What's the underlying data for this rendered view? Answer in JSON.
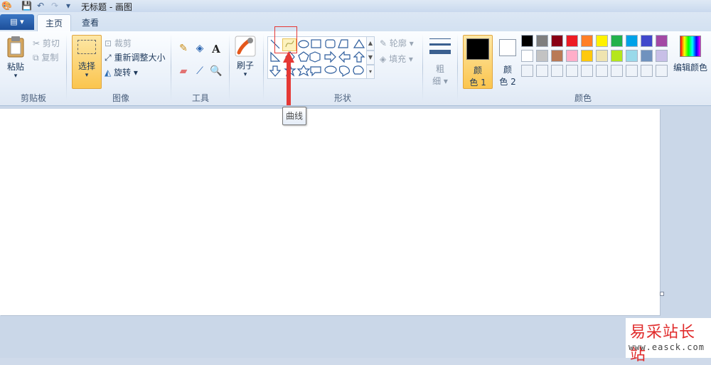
{
  "title_bar": {
    "title": "无标题 - 画图",
    "dropdown_arrow": "▾"
  },
  "file_menu": {
    "label": "▤ ▾"
  },
  "tabs": [
    {
      "label": "主页"
    },
    {
      "label": "查看"
    }
  ],
  "clipboard": {
    "paste": "粘贴",
    "paste_arrow": "▾",
    "cut": "剪切",
    "copy": "复制",
    "group": "剪贴板"
  },
  "image": {
    "select": "选择",
    "select_arrow": "▾",
    "crop": "裁剪",
    "resize": "重新调整大小",
    "rotate": "旋转 ▾",
    "group": "图像"
  },
  "tools": {
    "group": "工具"
  },
  "brushes": {
    "label": "刷子",
    "arrow": "▾"
  },
  "shapes": {
    "outline": "轮廓 ▾",
    "fill": "填充 ▾",
    "group": "形状"
  },
  "size": {
    "line1": "粗",
    "line2": "细 ▾"
  },
  "colors": {
    "color1_label_a": "颜",
    "color1_label_b": "色 1",
    "color2_label_a": "颜",
    "color2_label_b": "色 2",
    "edit": "编辑颜色",
    "group": "颜色",
    "color1": "#000000",
    "color2": "#ffffff",
    "palette_row1": [
      "#000000",
      "#7f7f7f",
      "#880015",
      "#ed1c24",
      "#ff7f27",
      "#fff200",
      "#22b14c",
      "#00a2e8",
      "#3f48cc",
      "#a349a4"
    ],
    "palette_row2": [
      "#ffffff",
      "#c3c3c3",
      "#b97a57",
      "#ffaec9",
      "#ffc90e",
      "#efe4b0",
      "#b5e61d",
      "#99d9ea",
      "#7092be",
      "#c8bfe7"
    ]
  },
  "tooltip": {
    "text": "曲线"
  },
  "watermark": {
    "chinese": "易采站长站",
    "url": "www.easck.com"
  }
}
